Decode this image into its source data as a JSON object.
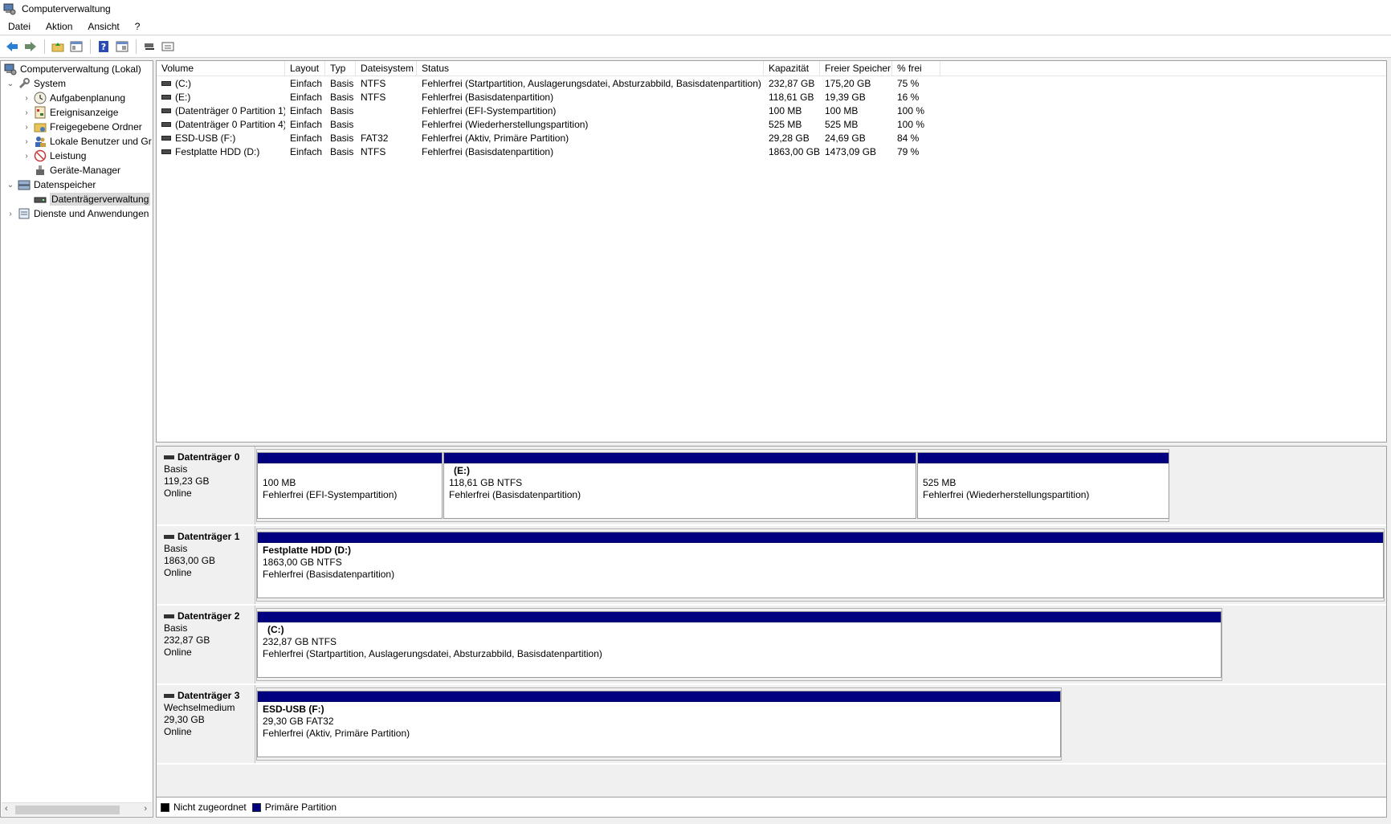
{
  "window": {
    "title": "Computerverwaltung"
  },
  "menu": [
    "Datei",
    "Aktion",
    "Ansicht",
    "?"
  ],
  "toolbar": [
    "back-icon",
    "forward-icon",
    "up-folder-icon",
    "show-hide-tree-icon",
    "help-icon",
    "properties-icon",
    "connect-icon",
    "console-icon"
  ],
  "tree": {
    "root": "Computerverwaltung (Lokal)",
    "system": "System",
    "aufgaben": "Aufgabenplanung",
    "ereignis": "Ereignisanzeige",
    "freigegeben": "Freigegebene Ordner",
    "benutzer": "Lokale Benutzer und Gr",
    "leistung": "Leistung",
    "geraete": "Geräte-Manager",
    "datenspeicher": "Datenspeicher",
    "dtv": "Datenträgerverwaltung",
    "dienste": "Dienste und Anwendungen"
  },
  "columns": [
    "Volume",
    "Layout",
    "Typ",
    "Dateisystem",
    "Status",
    "Kapazität",
    "Freier Speicher",
    "% frei"
  ],
  "volumes": [
    [
      "(C:)",
      "Einfach",
      "Basis",
      "NTFS",
      "Fehlerfrei (Startpartition, Auslagerungsdatei, Absturzabbild, Basisdatenpartition)",
      "232,87 GB",
      "175,20 GB",
      "75 %"
    ],
    [
      "(E:)",
      "Einfach",
      "Basis",
      "NTFS",
      "Fehlerfrei (Basisdatenpartition)",
      "118,61 GB",
      "19,39 GB",
      "16 %"
    ],
    [
      "(Datenträger 0 Partition 1)",
      "Einfach",
      "Basis",
      "",
      "Fehlerfrei (EFI-Systempartition)",
      "100 MB",
      "100 MB",
      "100 %"
    ],
    [
      "(Datenträger 0 Partition 4)",
      "Einfach",
      "Basis",
      "",
      "Fehlerfrei (Wiederherstellungspartition)",
      "525 MB",
      "525 MB",
      "100 %"
    ],
    [
      "ESD-USB (F:)",
      "Einfach",
      "Basis",
      "FAT32",
      "Fehlerfrei (Aktiv, Primäre Partition)",
      "29,28 GB",
      "24,69 GB",
      "84 %"
    ],
    [
      "Festplatte HDD (D:)",
      "Einfach",
      "Basis",
      "NTFS",
      "Fehlerfrei (Basisdatenpartition)",
      "1863,00 GB",
      "1473,09 GB",
      "79 %"
    ]
  ],
  "disks": {
    "d0": {
      "name": "Datenträger 0",
      "type": "Basis",
      "size": "119,23 GB",
      "state": "Online",
      "p1": {
        "size": "100 MB",
        "status": "Fehlerfrei (EFI-Systempartition)"
      },
      "p2": {
        "name": "(E:)",
        "size": "118,61 GB NTFS",
        "status": "Fehlerfrei (Basisdatenpartition)"
      },
      "p3": {
        "size": "525 MB",
        "status": "Fehlerfrei (Wiederherstellungspartition)"
      }
    },
    "d1": {
      "name": "Datenträger 1",
      "type": "Basis",
      "size": "1863,00 GB",
      "state": "Online",
      "p1": {
        "name": "Festplatte HDD  (D:)",
        "size": "1863,00 GB NTFS",
        "status": "Fehlerfrei (Basisdatenpartition)"
      }
    },
    "d2": {
      "name": "Datenträger 2",
      "type": "Basis",
      "size": "232,87 GB",
      "state": "Online",
      "p1": {
        "name": "(C:)",
        "size": "232,87 GB NTFS",
        "status": "Fehlerfrei (Startpartition, Auslagerungsdatei, Absturzabbild, Basisdatenpartition)"
      }
    },
    "d3": {
      "name": "Datenträger 3",
      "type": "Wechselmedium",
      "size": "29,30 GB",
      "state": "Online",
      "p1": {
        "name": "ESD-USB  (F:)",
        "size": "29,30 GB FAT32",
        "status": "Fehlerfrei (Aktiv, Primäre Partition)"
      }
    }
  },
  "legend": {
    "unallocated": "Nicht zugeordnet",
    "primary": "Primäre Partition"
  },
  "colors": {
    "primary": "#000080",
    "unallocated": "#000000"
  }
}
